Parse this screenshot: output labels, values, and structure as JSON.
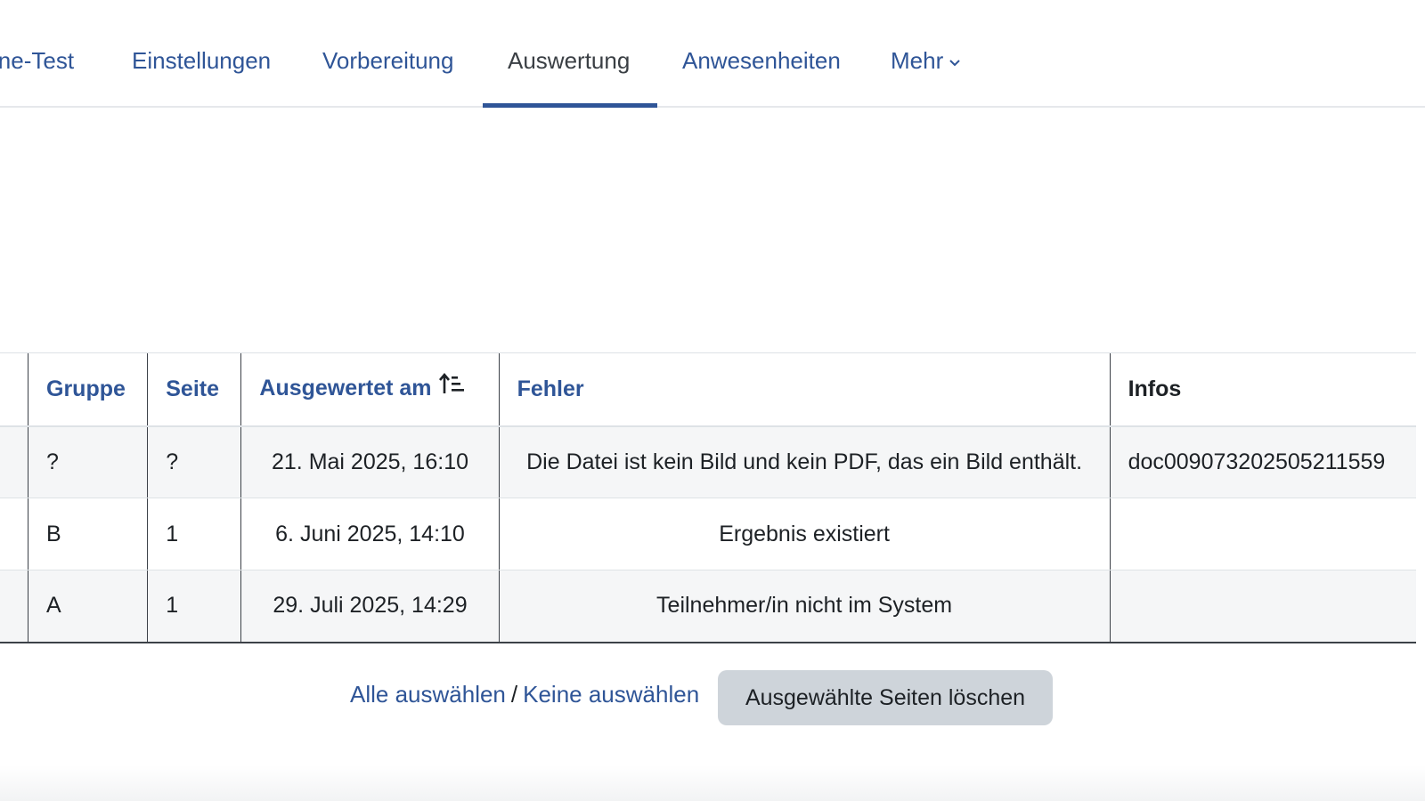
{
  "tabs": [
    {
      "label": "ine-Test"
    },
    {
      "label": "Einstellungen"
    },
    {
      "label": "Vorbereitung"
    },
    {
      "label": "Auswertung",
      "active": true
    },
    {
      "label": "Anwesenheiten"
    },
    {
      "label": "Mehr"
    }
  ],
  "table": {
    "headers": {
      "gruppe": "Gruppe",
      "seite": "Seite",
      "ausgewertet_am": "Ausgewertet am",
      "fehler": "Fehler",
      "infos": "Infos"
    },
    "rows": [
      {
        "gruppe": "?",
        "seite": "?",
        "ausgewertet_am": "21. Mai 2025, 16:10",
        "fehler": "Die Datei ist kein Bild und kein PDF, das ein Bild enthält.",
        "infos": "doc009073202505211559"
      },
      {
        "gruppe": "B",
        "seite": "1",
        "ausgewertet_am": "6. Juni 2025, 14:10",
        "fehler": "Ergebnis existiert",
        "infos": ""
      },
      {
        "gruppe": "A",
        "seite": "1",
        "ausgewertet_am": "29. Juli 2025, 14:29",
        "fehler": "Teilnehmer/in nicht im System",
        "infos": ""
      }
    ]
  },
  "actions": {
    "select_all": "Alle auswählen",
    "separator": "/",
    "select_none": "Keine auswählen",
    "delete_button": "Ausgewählte Seiten löschen"
  },
  "icons": {
    "sort": "sort-ascending-icon",
    "chevron": "chevron-down-icon"
  },
  "colors": {
    "link": "#2f5597",
    "active_tab_underline": "#2f5597",
    "button_bg": "#ced4da",
    "stripe": "#f5f6f7"
  }
}
